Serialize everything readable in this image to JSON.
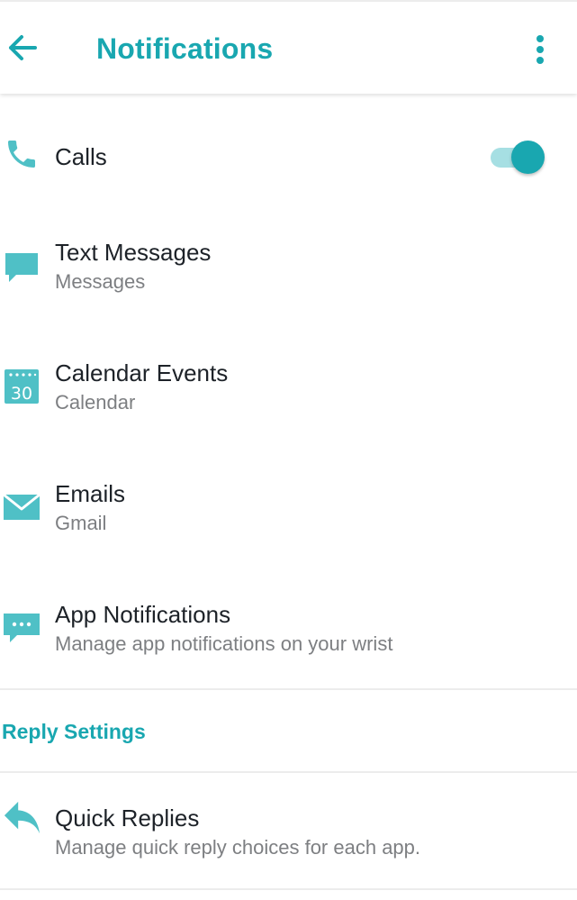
{
  "header": {
    "title": "Notifications",
    "back_icon": "arrow-left-icon",
    "menu_icon": "more-vertical-icon"
  },
  "items": [
    {
      "label": "Calls",
      "sublabel": "",
      "icon": "phone-icon",
      "toggle": true
    },
    {
      "label": "Text Messages",
      "sublabel": "Messages",
      "icon": "message-icon"
    },
    {
      "label": "Calendar Events",
      "sublabel": "Calendar",
      "icon": "calendar-icon",
      "icon_text": "30"
    },
    {
      "label": "Emails",
      "sublabel": "Gmail",
      "icon": "mail-icon"
    },
    {
      "label": "App Notifications",
      "sublabel": "Manage app notifications on your wrist",
      "icon": "chat-dots-icon"
    }
  ],
  "reply_section": {
    "header": "Reply Settings",
    "items": [
      {
        "label": "Quick Replies",
        "sublabel": "Manage quick reply choices for each app.",
        "icon": "reply-icon"
      }
    ]
  },
  "colors": {
    "accent": "#19a7b0",
    "icon": "#4fc0c6",
    "toggle_track": "#a6dfe3",
    "text_primary": "#1d2228",
    "text_secondary": "#7d7f82",
    "divider": "#ececec"
  }
}
